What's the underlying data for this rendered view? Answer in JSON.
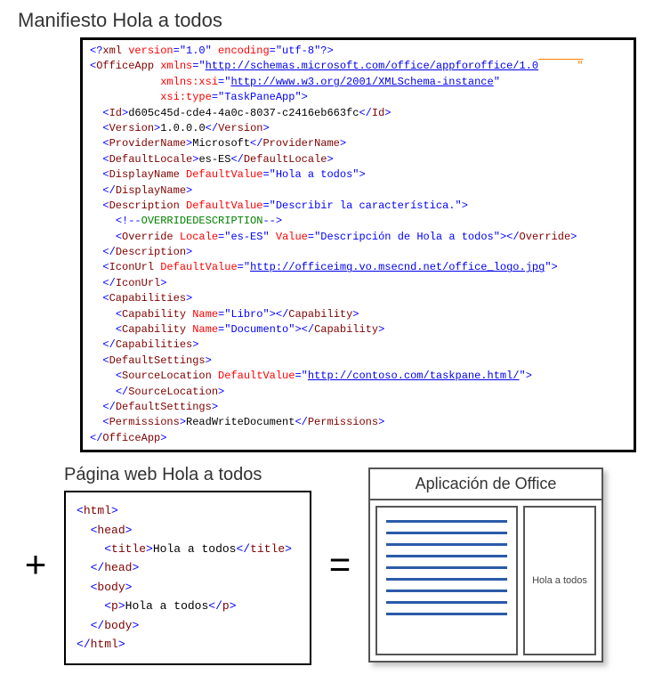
{
  "titles": {
    "manifest": "Manifiesto Hola a todos",
    "webpage": "Página web Hola a todos",
    "appmock": "Aplicación de Office",
    "pane": "Hola a todos"
  },
  "symbols": {
    "plus": "+",
    "equals": "="
  },
  "xml": {
    "decl_open": "<?",
    "decl_xml": "xml",
    "decl_ver_attr": " version",
    "decl_eq": "=",
    "decl_ver_val": "\"1.0\"",
    "decl_enc_attr": " encoding",
    "decl_enc_val": "\"utf-8\"",
    "decl_close": "?>",
    "lt": "<",
    "gt": ">",
    "slash": "/",
    "OfficeApp": "OfficeApp",
    "xmlns_attr": " xmlns",
    "xmlns_val_q": "\"",
    "xmlns_url": "http://schemas.microsoft.com/office/appforoffice/1.0",
    "xmlnsxsi_attr": "xmlns:xsi",
    "xsi_url": "http://www.w3.org/2001/XMLSchema-instance",
    "xsitype_attr": "xsi:type",
    "xsitype_val": "\"TaskPaneApp\"",
    "Id": "Id",
    "id_val": "d605c45d-cde4-4a0c-8037-c2416eb663fc",
    "Version": "Version",
    "version_val": "1.0.0.0",
    "ProviderName": "ProviderName",
    "provider_val": "Microsoft",
    "DefaultLocale": "DefaultLocale",
    "locale_val": "es-ES",
    "DisplayName": "DisplayName",
    "DefaultValue_attr": " DefaultValue",
    "display_val": "\"Hola a todos\"",
    "Description": "Description",
    "desc_val": "\"Describir la característica.\"",
    "comment_open": "<!--",
    "comment_txt": "OVERRIDEDESCRIPTION",
    "comment_close": "-->",
    "Override": "Override",
    "Locale_attr": " Locale",
    "locale_es": "\"es-ES\"",
    "Value_attr": " Value",
    "override_val": "\"Descripción de Hola a todos\"",
    "IconUrl": "IconUrl",
    "icon_url": "http://officeimg.vo.msecnd.net/office_logo.jpg",
    "Capabilities": "Capabilities",
    "Capability": "Capability",
    "Name_attr": " Name",
    "cap_libro": "\"Libro\"",
    "cap_doc": "\"Documento\"",
    "DefaultSettings": "DefaultSettings",
    "SourceLocation": "SourceLocation",
    "src_url": "http://contoso.com/taskpane.html/",
    "Permissions": "Permissions",
    "perm_val": "ReadWriteDocument",
    "indent1": "  ",
    "indent2": "    ",
    "indent3": "      ",
    "pad_xmlns": "           ",
    "orange_tail": "      \""
  },
  "html": {
    "html": "html",
    "head": "head",
    "title": "title",
    "body": "body",
    "p": "p",
    "title_txt": "Hola a todos",
    "p_txt": "Hola a todos",
    "lt": "<",
    "gt": ">",
    "slash": "/",
    "ind1": "  ",
    "ind2": "    "
  }
}
